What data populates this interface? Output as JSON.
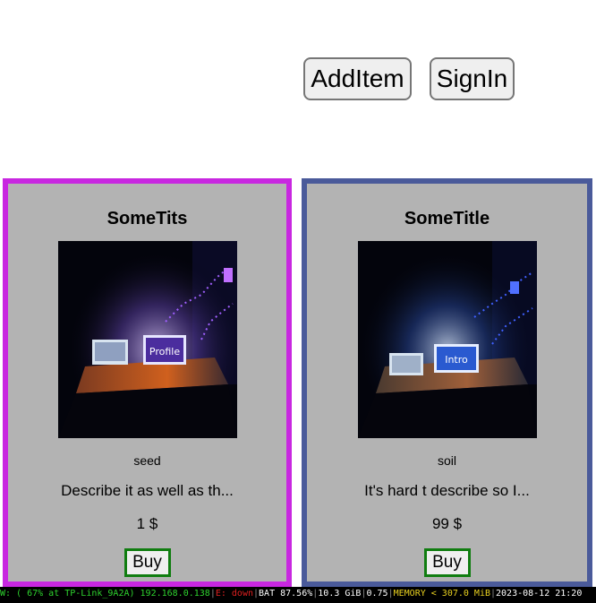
{
  "header": {
    "add_item_label": "AddItem",
    "sign_in_label": "SignIn"
  },
  "products": [
    {
      "title": "SomeTits",
      "category": "seed",
      "description": "Describe it as well as th...",
      "price": "1 $",
      "buy_label": "Buy",
      "image_text": "Profile",
      "border_color": "#c827e0"
    },
    {
      "title": "SomeTitle",
      "category": "soil",
      "description": "It's hard t describe so I...",
      "price": "99 $",
      "buy_label": "Buy",
      "image_text": "Intro",
      "border_color": "#4a5a9a"
    }
  ],
  "statusbar": {
    "wifi": "W: ( 67% at TP-Link_9A2A) 192.168.0.138",
    "ethernet": "E: down",
    "battery": "BAT 87.56%",
    "disk": "10.3 GiB",
    "load": "0.75",
    "memory": "MEMORY < 307.0 MiB",
    "datetime": "2023-08-12 21:20"
  },
  "colors": {
    "wifi": "#2ed12e",
    "ethernet": "#e02020",
    "memory": "#e8d020",
    "card_bg": "#b3b3b3",
    "buy_border": "#107d10"
  }
}
